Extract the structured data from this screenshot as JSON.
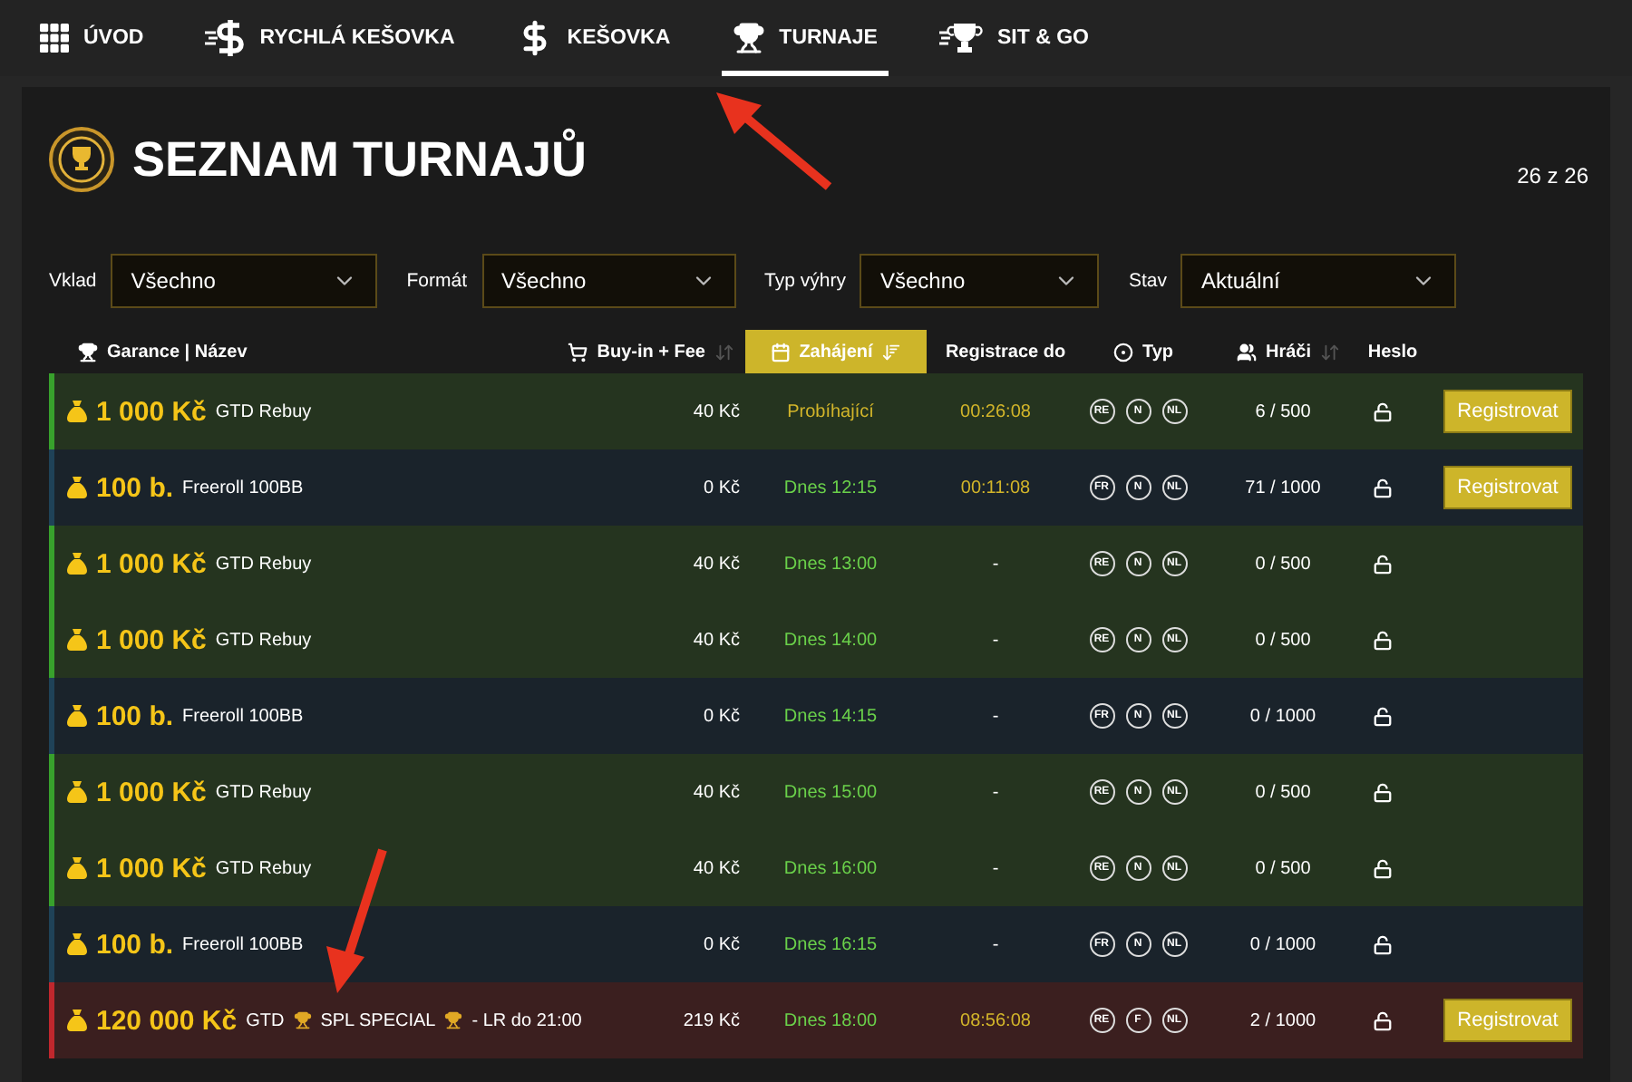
{
  "nav": [
    {
      "label": "ÚVOD",
      "selected": false
    },
    {
      "label": "RYCHLÁ KEŠOVKA",
      "selected": false
    },
    {
      "label": "KEŠOVKA",
      "selected": false
    },
    {
      "label": "TURNAJE",
      "selected": true
    },
    {
      "label": "SIT & GO",
      "selected": false
    }
  ],
  "title": "SEZNAM TURNAJŮ",
  "count": "26 z 26",
  "filters": [
    {
      "label": "Vklad",
      "value": "Všechno"
    },
    {
      "label": "Formát",
      "value": "Všechno"
    },
    {
      "label": "Typ výhry",
      "value": "Všechno"
    },
    {
      "label": "Stav",
      "value": "Aktuální"
    }
  ],
  "columns": [
    {
      "label": "Garance | Název",
      "sortable": false,
      "selected": false
    },
    {
      "label": "Buy-in + Fee",
      "sortable": true,
      "selected": false
    },
    {
      "label": "Zahájení",
      "sortable": true,
      "selected": true
    },
    {
      "label": "Registrace do",
      "sortable": false,
      "selected": false
    },
    {
      "label": "Typ",
      "sortable": false,
      "selected": false
    },
    {
      "label": "Hráči",
      "sortable": true,
      "selected": false
    },
    {
      "label": "Heslo",
      "sortable": false,
      "selected": false
    }
  ],
  "rows": [
    {
      "kind": "gtd",
      "guarantee": "1 000 Kč",
      "name": "GTD Rebuy",
      "buyin": "40 Kč",
      "start": "Probíhající",
      "live": true,
      "reg": "00:26:08",
      "types": [
        "RE",
        "N",
        "NL"
      ],
      "players": "6 / 500",
      "button": "Registrovat"
    },
    {
      "kind": "freeroll",
      "guarantee": "100 b.",
      "name": "Freeroll 100BB",
      "buyin": "0 Kč",
      "start": "Dnes 12:15",
      "live": false,
      "reg": "00:11:08",
      "types": [
        "FR",
        "N",
        "NL"
      ],
      "players": "71 / 1000",
      "button": "Registrovat"
    },
    {
      "kind": "gtd",
      "guarantee": "1 000 Kč",
      "name": "GTD Rebuy",
      "buyin": "40 Kč",
      "start": "Dnes 13:00",
      "live": false,
      "reg": "-",
      "types": [
        "RE",
        "N",
        "NL"
      ],
      "players": "0 / 500"
    },
    {
      "kind": "gtd",
      "guarantee": "1 000 Kč",
      "name": "GTD Rebuy",
      "buyin": "40 Kč",
      "start": "Dnes 14:00",
      "live": false,
      "reg": "-",
      "types": [
        "RE",
        "N",
        "NL"
      ],
      "players": "0 / 500"
    },
    {
      "kind": "freeroll",
      "guarantee": "100 b.",
      "name": "Freeroll 100BB",
      "buyin": "0 Kč",
      "start": "Dnes 14:15",
      "live": false,
      "reg": "-",
      "types": [
        "FR",
        "N",
        "NL"
      ],
      "players": "0 / 1000"
    },
    {
      "kind": "gtd",
      "guarantee": "1 000 Kč",
      "name": "GTD Rebuy",
      "buyin": "40 Kč",
      "start": "Dnes 15:00",
      "live": false,
      "reg": "-",
      "types": [
        "RE",
        "N",
        "NL"
      ],
      "players": "0 / 500"
    },
    {
      "kind": "gtd",
      "guarantee": "1 000 Kč",
      "name": "GTD Rebuy",
      "buyin": "40 Kč",
      "start": "Dnes 16:00",
      "live": false,
      "reg": "-",
      "types": [
        "RE",
        "N",
        "NL"
      ],
      "players": "0 / 500"
    },
    {
      "kind": "freeroll",
      "guarantee": "100 b.",
      "name": "Freeroll 100BB",
      "buyin": "0 Kč",
      "start": "Dnes 16:15",
      "live": false,
      "reg": "-",
      "types": [
        "FR",
        "N",
        "NL"
      ],
      "players": "0 / 1000"
    },
    {
      "kind": "special",
      "guarantee": "120 000 Kč",
      "name": "GTD",
      "special_title": "SPL SPECIAL",
      "suffix": "- LR do 21:00",
      "buyin": "219 Kč",
      "start": "Dnes 18:00",
      "live": false,
      "reg": "08:56:08",
      "types": [
        "RE",
        "F",
        "NL"
      ],
      "players": "2 / 1000",
      "button": "Registrovat"
    }
  ]
}
